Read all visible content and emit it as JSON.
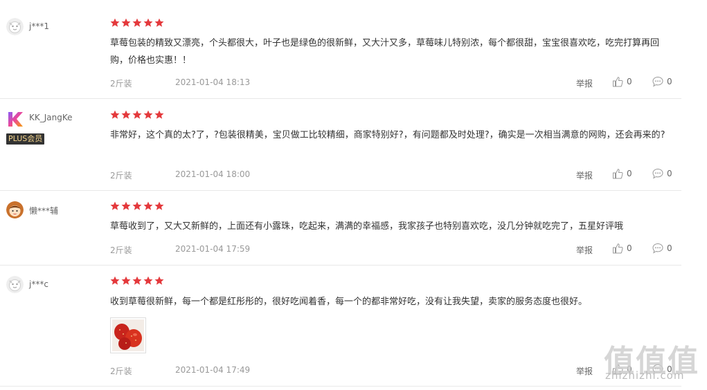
{
  "colors": {
    "star": "#e4393c",
    "plus_bg": "#333333",
    "plus_text": "#f5d58c"
  },
  "reviews": [
    {
      "user": "j***1",
      "avatar_icon": "default-avatar-icon",
      "rating": 5,
      "content": "草莓包装的精致又漂亮，个头都很大，叶子也是绿色的很新鲜，又大汁又多，草莓味儿特别浓，每个都很甜，宝宝很喜欢吃，吃完打算再回购，价格也实惠！！",
      "spec": "2斤装",
      "time": "2021-01-04 18:13",
      "report": "举报",
      "likes": "0",
      "replies": "0"
    },
    {
      "user": "KK_JangKe",
      "avatar_icon": "k-logo-avatar-icon",
      "badge": "PLUS会员",
      "rating": 5,
      "content": "非常好，这个真的太?了，?包装很精美，宝贝做工比较精细，商家特别好?，有问题都及时处理?，确实是一次相当满意的网购，还会再来的?",
      "spec": "2斤装",
      "time": "2021-01-04 18:00",
      "report": "举报",
      "likes": "0",
      "replies": "0"
    },
    {
      "user": "懒***辅",
      "avatar_icon": "cartoon-girl-avatar-icon",
      "rating": 5,
      "content": "草莓收到了，又大又新鲜的，上面还有小露珠，吃起来，满满的幸福感，我家孩子也特别喜欢吃，没几分钟就吃完了，五星好评哦",
      "spec": "2斤装",
      "time": "2021-01-04 17:59",
      "report": "举报",
      "likes": "0",
      "replies": "0"
    },
    {
      "user": "j***c",
      "avatar_icon": "default-avatar-icon",
      "rating": 5,
      "content": "收到草莓很新鲜，每一个都是红彤彤的，很好吃闻着香，每一个的都非常好吃，没有让我失望，卖家的服务态度也很好。",
      "photo_icon": "strawberry-photo-icon",
      "spec": "2斤装",
      "time": "2021-01-04 17:49",
      "report": "举报",
      "likes": "0",
      "replies": "0"
    }
  ],
  "watermark": {
    "chars": "值值值",
    "domain": "zhizhizhi.com"
  }
}
